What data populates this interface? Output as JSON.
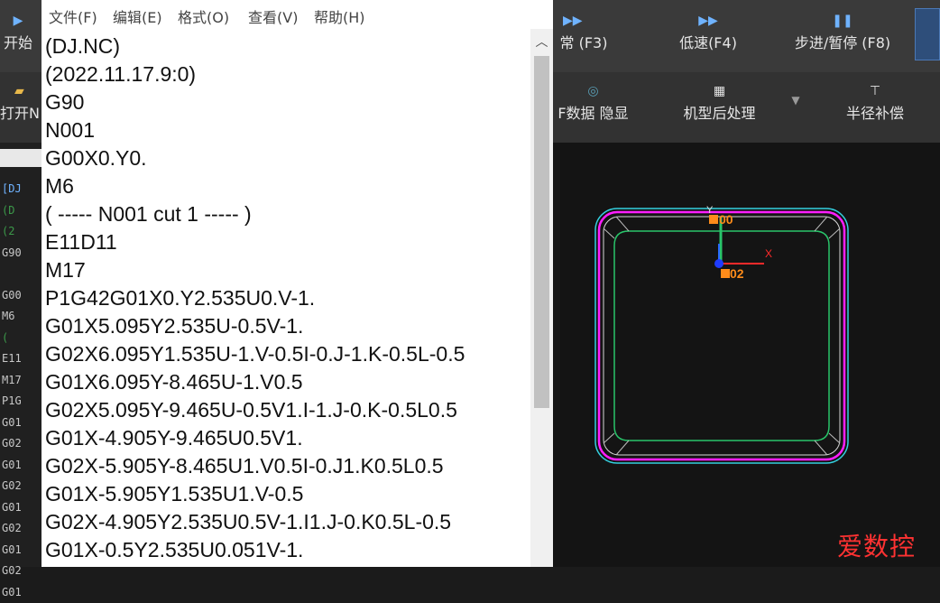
{
  "background_app": {
    "toolbar_row1": {
      "start_label": "开始",
      "normal_speed_label": "常 (F3)",
      "low_speed_label": "低速(F4)",
      "step_pause_label": "步进/暂停 (F8)"
    },
    "toolbar_row2": {
      "open_label": "打开N",
      "data_toggle_label": "F数据 隐显",
      "postprocess_label": "机型后处理",
      "radius_comp_label": "半径补偿"
    },
    "left_code_preview": [
      "[DJ",
      "(D",
      "(2",
      "G90",
      "",
      "G00",
      "M6",
      "(",
      "E11",
      "M17",
      "P1G",
      "G01",
      "G02",
      "G01",
      "G02",
      "G01",
      "G02",
      "G01",
      "G02",
      "G01"
    ],
    "canvas": {
      "label_start": "00",
      "label_end": "02",
      "axis_y_label": "Y",
      "axis_x_label": "X"
    },
    "watermark": "爱数控",
    "colors": {
      "outer_contour": "#ff1dff",
      "toolpath": "#29c46a",
      "lead_line": "#34d0e0",
      "accent_blue": "#6fb3ff"
    }
  },
  "notepad": {
    "menu": [
      "文件(F)",
      "编辑(E)",
      "格式(O)",
      "查看(V)",
      "帮助(H)"
    ],
    "lines": [
      "(DJ.NC)",
      "(2022.11.17.9:0)",
      "G90",
      "N001",
      "G00X0.Y0.",
      "M6",
      "( ----- N001 cut 1 ----- )",
      "E11D11",
      "M17",
      "P1G42G01X0.Y2.535U0.V-1.",
      "G01X5.095Y2.535U-0.5V-1.",
      "G02X6.095Y1.535U-1.V-0.5I-0.J-1.K-0.5L-0.5",
      "G01X6.095Y-8.465U-1.V0.5",
      "G02X5.095Y-9.465U-0.5V1.I-1.J-0.K-0.5L0.5",
      "G01X-4.905Y-9.465U0.5V1.",
      "G02X-5.905Y-8.465U1.V0.5I-0.J1.K0.5L0.5",
      "G01X-5.905Y1.535U1.V-0.5",
      "G02X-4.905Y2.535U0.5V-1.I1.J-0.K0.5L-0.5",
      "G01X-0.5Y2.535U0.051V-1."
    ]
  }
}
